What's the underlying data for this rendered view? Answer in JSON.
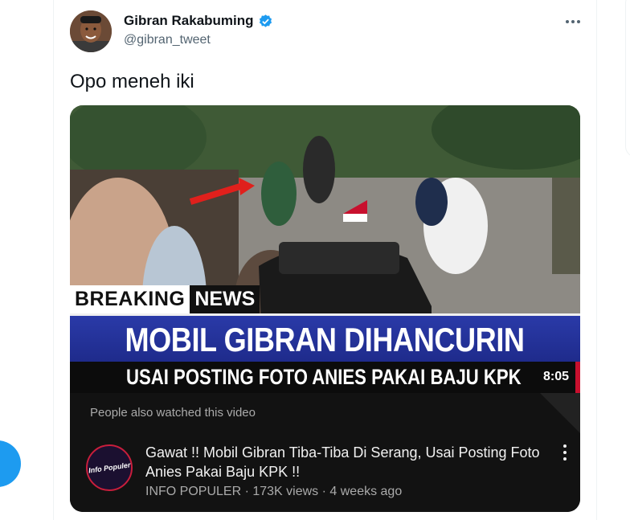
{
  "author": {
    "name": "Gibran Rakabuming",
    "handle": "@gibran_tweet",
    "verified": true
  },
  "tweet": {
    "text": "Opo meneh iki"
  },
  "video": {
    "breaking_left": "BREAKING",
    "breaking_right": "NEWS",
    "headline": "MOBIL GIBRAN DIHANCURIN",
    "subheadline": "USAI POSTING FOTO ANIES PAKAI BAJU KPK",
    "duration": "8:05",
    "also_watched": "People also watched this video",
    "suggested": {
      "title": "Gawat !! Mobil Gibran Tiba-Tiba Di Serang, Usai Posting Foto Anies Pakai Baju KPK !!",
      "meta": "INFO POPULER · 173K views · 4 weeks ago",
      "channel_logo_text": "Info Populer"
    }
  },
  "colors": {
    "accent": "#1d9bf0",
    "banner_blue": "#1e2a8a",
    "banner_red": "#c8102e"
  },
  "icons": [
    "verified-badge-icon",
    "more-options-icon",
    "video-more-icon"
  ]
}
